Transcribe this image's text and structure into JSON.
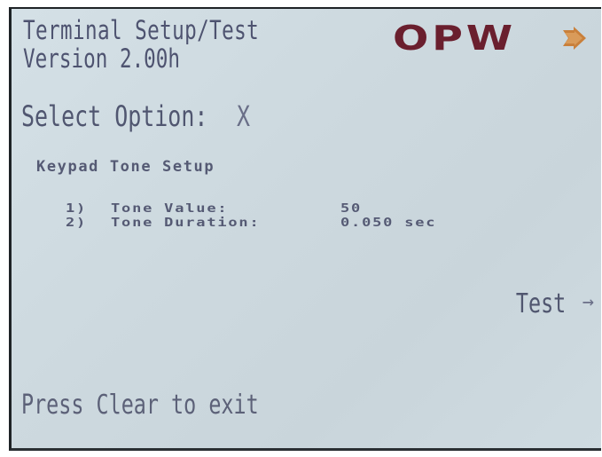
{
  "header": {
    "title": "Terminal Setup/Test",
    "version": "Version 2.00h"
  },
  "logo": {
    "text": "OPW",
    "icon": "opw-arrow-icon",
    "color": "#6a1f2e"
  },
  "prompt": {
    "label": "Select Option:",
    "value": "X"
  },
  "section": {
    "title": "Keypad Tone Setup",
    "options": [
      {
        "number": "1)",
        "label": "Tone Value:",
        "value": "50"
      },
      {
        "number": "2)",
        "label": "Tone Duration:",
        "value": "0.050 sec"
      }
    ]
  },
  "softkey": {
    "label": "Test",
    "icon": "right-arrow-icon"
  },
  "footer": {
    "hint": "Press Clear to exit"
  },
  "colors": {
    "lcd_background": "#cfdbe1",
    "lcd_text": "#4e5370"
  }
}
